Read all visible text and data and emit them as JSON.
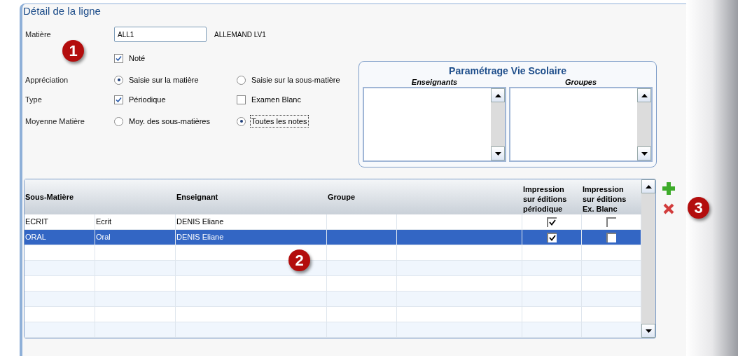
{
  "panel": {
    "title": "Détail de la ligne"
  },
  "form": {
    "matiere": {
      "label": "Matière",
      "value": "ALL1",
      "name": "ALLEMAND LV1"
    },
    "note": {
      "label": "Noté",
      "checked": true
    },
    "appreciation": {
      "label": "Appréciation",
      "options": [
        {
          "label": "Saisie sur la matière",
          "selected": true
        },
        {
          "label": "Saisie sur la sous-matière",
          "selected": false
        }
      ]
    },
    "type": {
      "label": "Type",
      "options": [
        {
          "label": "Périodique",
          "checked": true
        },
        {
          "label": "Examen Blanc",
          "checked": false
        }
      ]
    },
    "moyenne": {
      "label": "Moyenne Matière",
      "options": [
        {
          "label": "Moy. des sous-matières",
          "selected": false,
          "focused": false
        },
        {
          "label": "Toutes les notes",
          "selected": true,
          "focused": true
        }
      ]
    }
  },
  "vie_scolaire": {
    "title": "Paramétrage Vie Scolaire",
    "lists": [
      {
        "heading": "Enseignants"
      },
      {
        "heading": "Groupes"
      }
    ]
  },
  "table": {
    "headers": [
      "Sous-Matière",
      "Enseignant",
      "Groupe",
      "Impression\nsur éditions\npériodique",
      "Impression\nsur éditions\nEx. Blanc"
    ],
    "rows": [
      {
        "cells": [
          "ECRIT",
          "Ecrit",
          "DENIS Eliane"
        ],
        "periodique": true,
        "ex_blanc": false,
        "selected": false
      },
      {
        "cells": [
          "ORAL",
          "Oral",
          "DENIS Eliane"
        ],
        "periodique": true,
        "ex_blanc": false,
        "selected": true
      }
    ]
  },
  "callouts": [
    "1",
    "2",
    "3"
  ]
}
